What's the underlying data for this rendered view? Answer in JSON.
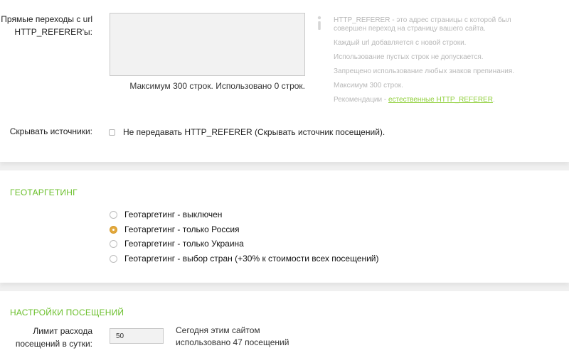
{
  "referer": {
    "label_line1": "Прямые переходы с url",
    "label_line2": "HTTP_REFERER'ы:",
    "textarea_value": "",
    "limit_note": "Максимум 300 строк. Использовано 0 строк.",
    "help_line1": "HTTP_REFERER - это адрес страницы с которой был",
    "help_line2": "совершен переход на страницу вашего сайта.",
    "help_line3": "Каждый url добавляется с новой строки.",
    "help_line4": "Использование пустых строк не допускается.",
    "help_line5": "Запрещено использование любых знаков препинания.",
    "help_line6": "Максимум 300 строк.",
    "help_recommend_prefix": "Рекомендации - ",
    "help_recommend_link": "естественные HTTP_REFERER",
    "help_recommend_suffix": "."
  },
  "hide_sources": {
    "label": "Скрывать источники:",
    "checkbox_label": "Не передавать HTTP_REFERER (Скрывать источник посещений).",
    "checked": false
  },
  "geo": {
    "title": "ГЕОТАРГЕТИНГ",
    "options": [
      {
        "label": "Геотаргетинг - выключен",
        "checked": false
      },
      {
        "label": "Геотаргетинг - только Россия",
        "checked": true
      },
      {
        "label": "Геотаргетинг - только Украина",
        "checked": false
      },
      {
        "label": "Геотаргетинг - выбор стран (+30% к стоимости всех посещений)",
        "checked": false
      }
    ]
  },
  "visits": {
    "title": "НАСТРОЙКИ ПОСЕЩЕНИЙ",
    "limit_label_line1": "Лимит расхода",
    "limit_label_line2": "посещений в сутки:",
    "limit_value": "50",
    "today_line1": "Сегодня этим сайтом",
    "today_line2": "использовано 47 посещений"
  },
  "colors": {
    "accent_green": "#6abf2a",
    "radio_selected": "#e3a93c",
    "help_text": "#b8b8b8"
  },
  "icons": {
    "info": "info-icon"
  }
}
